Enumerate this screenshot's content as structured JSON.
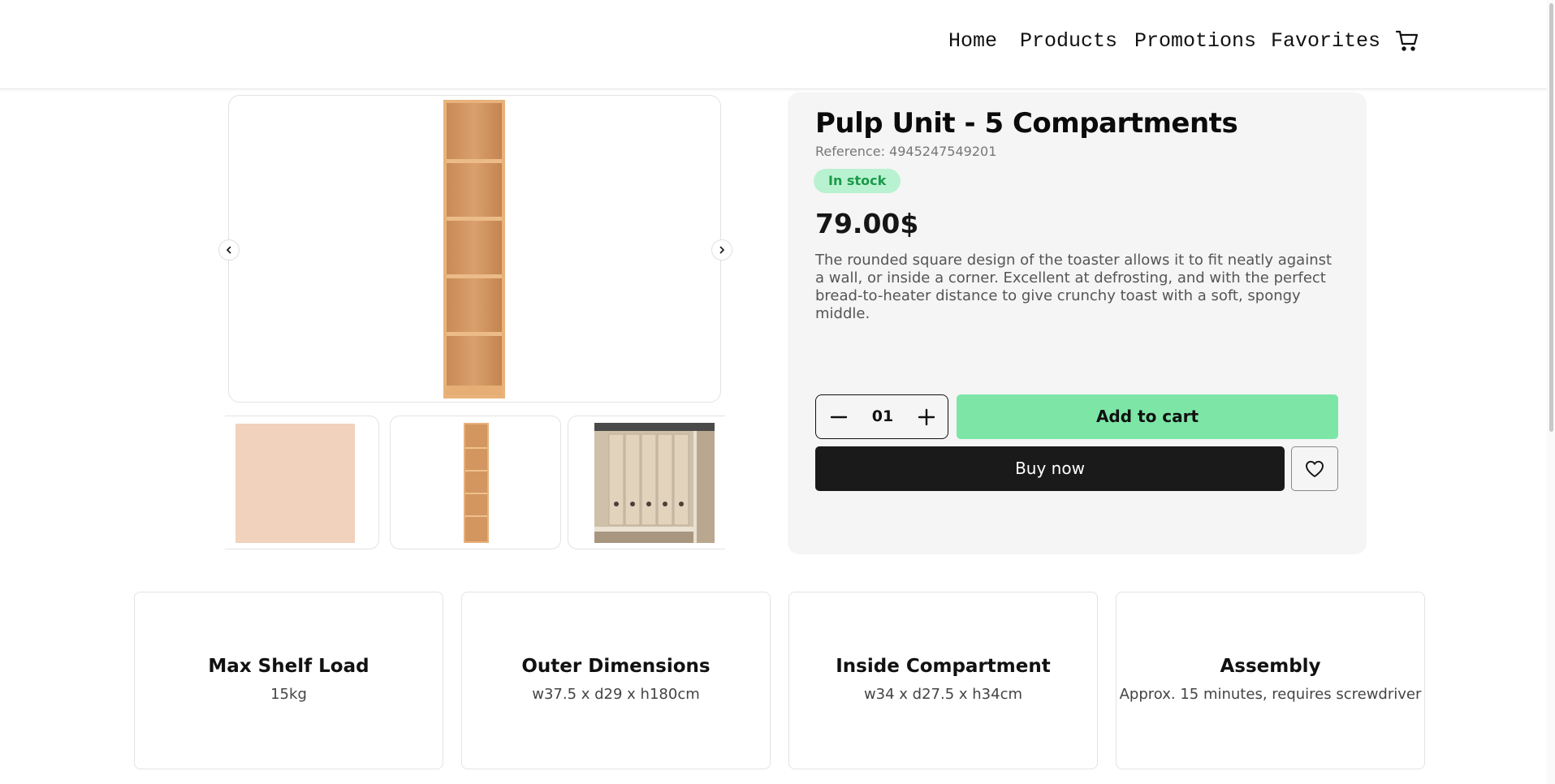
{
  "nav": {
    "items": [
      {
        "label": "Home"
      },
      {
        "label": "Products"
      },
      {
        "label": "Promotions"
      },
      {
        "label": "Favorites"
      }
    ],
    "cart_icon": "cart-icon"
  },
  "gallery": {
    "prev_icon": "chevron-left-icon",
    "next_icon": "chevron-right-icon",
    "selected_thumbnail": 2,
    "wood_color": "#c88a55"
  },
  "product": {
    "title": "Pulp Unit - 5 Compartments",
    "reference": "Reference: 4945247549201",
    "stock": "In stock",
    "price": "79.00$",
    "description": "The rounded square design of the toaster allows it to fit neatly against a wall, or inside a corner. Excellent at defrosting, and with the perfect bread-to-heater distance to give crunchy toast with a soft, spongy middle.",
    "quantity": "01",
    "add_to_cart": "Add to cart",
    "buy_now": "Buy now",
    "favorite_icon": "heart-icon"
  },
  "specs": [
    {
      "title": "Max Shelf Load",
      "value": "15kg"
    },
    {
      "title": "Outer Dimensions",
      "value": "w37.5 x d29 x h180cm"
    },
    {
      "title": "Inside Compartment",
      "value": "w34 x d27.5 x h34cm"
    },
    {
      "title": "Assembly",
      "value": "Approx. 15 minutes, requires screwdriver"
    }
  ],
  "colors": {
    "accent_green": "#7de6a6",
    "stock_badge_bg": "#b9f2d0",
    "stock_badge_text": "#1a9a4a",
    "buy_now_bg": "#1a1a1a",
    "panel_bg": "#f5f5f5"
  }
}
